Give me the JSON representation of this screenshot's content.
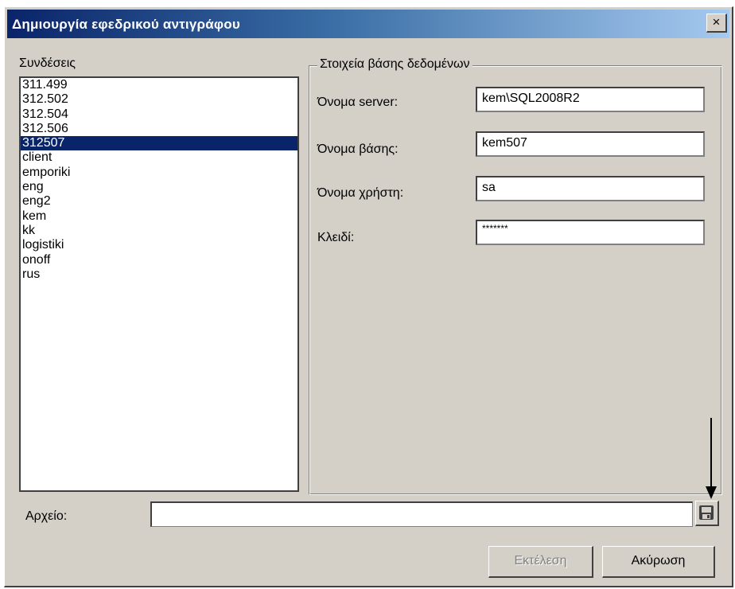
{
  "window": {
    "title": "Δημιουργία εφεδρικού αντιγράφου",
    "close_glyph": "×"
  },
  "connections": {
    "label": "Συνδέσεις",
    "items": [
      "311.499",
      "312.502",
      "312.504",
      "312.506",
      "312507",
      "client",
      "emporiki",
      "eng",
      "eng2",
      "kem",
      "kk",
      "logistiki",
      "onoff",
      "rus"
    ],
    "selected": "312507"
  },
  "db_details": {
    "legend": "Στοιχεία βάσης δεδομένων",
    "server_label": "Όνομα server:",
    "server_value": "kem\\SQL2008R2",
    "database_label": "Όνομα βάσης:",
    "database_value": "kem507",
    "user_label": "Όνομα χρήστη:",
    "user_value": "sa",
    "password_label": "Κλειδί:",
    "password_value": "*******"
  },
  "file": {
    "label": "Αρχείο:",
    "value": "",
    "browse_icon": "save-disk-icon"
  },
  "buttons": {
    "execute_label": "Εκτέλεση",
    "execute_enabled": false,
    "cancel_label": "Ακύρωση"
  },
  "colors": {
    "dialog_bg": "#d4d0c8",
    "titlebar_start": "#0a246a",
    "titlebar_end": "#a6caf0",
    "selection": "#0a246a"
  }
}
